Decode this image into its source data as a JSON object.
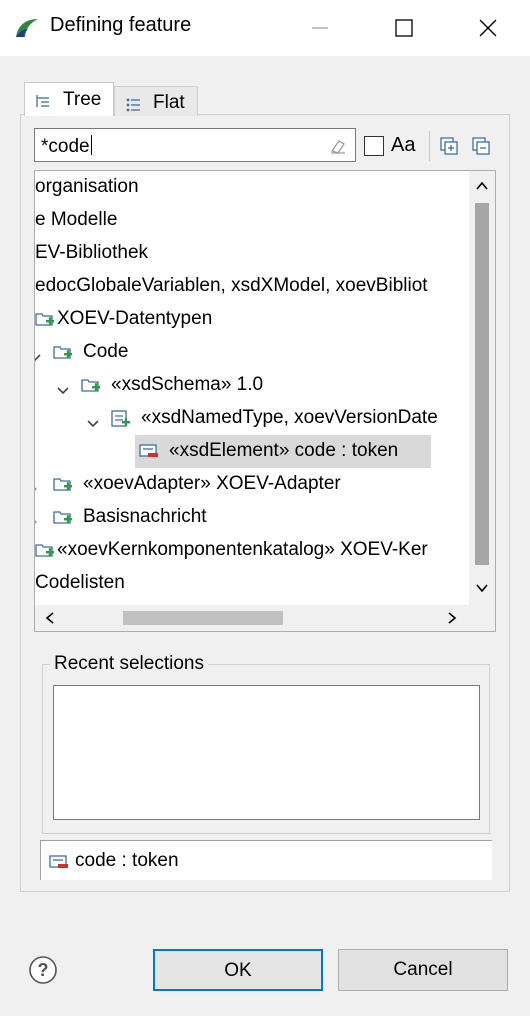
{
  "window": {
    "title": "Defining feature",
    "icon": "eclipse-app-icon",
    "controls": [
      "minimize-icon",
      "maximize-icon",
      "close-icon"
    ]
  },
  "tabs": [
    {
      "label": "Tree",
      "icon": "tree-view-icon",
      "selected": true
    },
    {
      "label": "Flat",
      "icon": "flat-list-icon",
      "selected": false
    }
  ],
  "search": {
    "value": "*code",
    "clear_icon": "eraser-icon",
    "match_case_label": "Aa",
    "match_case_checked": false
  },
  "tree": {
    "rows": [
      {
        "label": "organisation",
        "icon": "",
        "twisty": "",
        "selected": false
      },
      {
        "label": "e Modelle",
        "icon": "",
        "twisty": "",
        "selected": false
      },
      {
        "label": "EV-Bibliothek",
        "icon": "",
        "twisty": "",
        "selected": false
      },
      {
        "label": "edocGlobaleVariablen, xsdXModel, xoevBibliot",
        "icon": "",
        "twisty": "",
        "selected": false
      },
      {
        "label": "XOEV-Datentypen",
        "icon": "package-icon",
        "twisty": "",
        "selected": false
      },
      {
        "label": "Code",
        "icon": "package-icon",
        "twisty": "expanded",
        "selected": false
      },
      {
        "label": "«xsdSchema» 1.0",
        "icon": "package-icon",
        "twisty": "expanded",
        "selected": false
      },
      {
        "label": "«xsdNamedType, xoevVersionDate",
        "icon": "class-icon",
        "twisty": "expanded",
        "selected": false
      },
      {
        "label": "«xsdElement» code : token",
        "icon": "attribute-icon",
        "twisty": "",
        "selected": true
      },
      {
        "label": "«xoevAdapter» XOEV-Adapter",
        "icon": "package-icon",
        "twisty": "collapsed",
        "selected": false
      },
      {
        "label": "Basisnachricht",
        "icon": "package-icon",
        "twisty": "collapsed",
        "selected": false
      },
      {
        "label": "«xoevKernkomponentenkatalog» XOEV-Ker",
        "icon": "package-icon",
        "twisty": "",
        "selected": false
      },
      {
        "label": "Codelisten",
        "icon": "",
        "twisty": "",
        "selected": false
      }
    ]
  },
  "recent": {
    "label": "Recent selections",
    "items": []
  },
  "selection": {
    "label": "code : token",
    "icon": "attribute-icon"
  },
  "buttons": {
    "ok": "OK",
    "cancel": "Cancel",
    "help_icon": "help-icon"
  }
}
